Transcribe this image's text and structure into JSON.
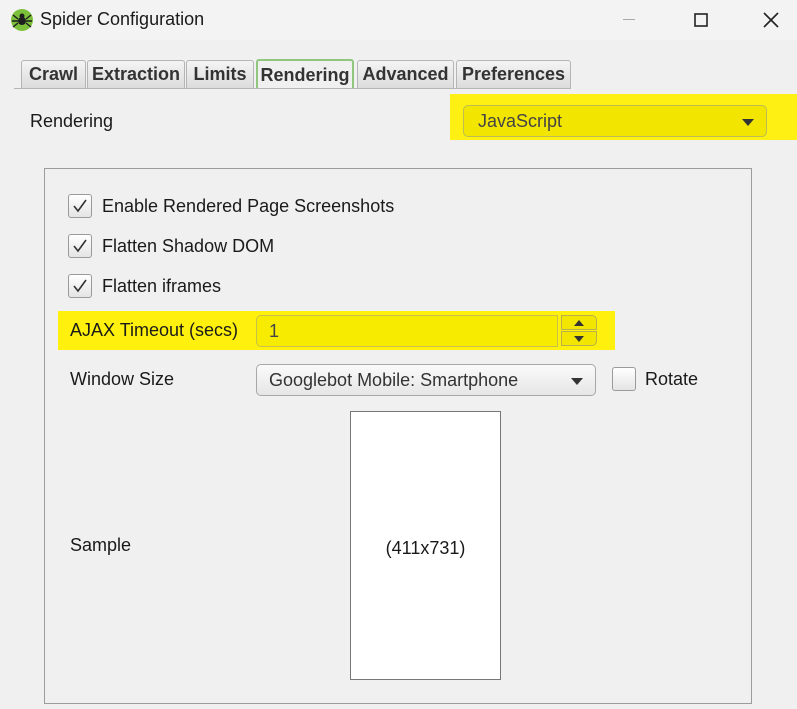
{
  "window": {
    "title": "Spider Configuration",
    "icon": "spider-icon"
  },
  "tabs": [
    {
      "label": "Crawl",
      "active": false
    },
    {
      "label": "Extraction",
      "active": false
    },
    {
      "label": "Limits",
      "active": false
    },
    {
      "label": "Rendering",
      "active": true
    },
    {
      "label": "Advanced",
      "active": false
    },
    {
      "label": "Preferences",
      "active": false
    }
  ],
  "rendering": {
    "label": "Rendering",
    "selected": "JavaScript"
  },
  "options": {
    "screenshots": {
      "label": "Enable Rendered Page Screenshots",
      "checked": true
    },
    "shadow_dom": {
      "label": "Flatten Shadow DOM",
      "checked": true
    },
    "iframes": {
      "label": "Flatten iframes",
      "checked": true
    }
  },
  "ajax": {
    "label": "AJAX Timeout (secs)",
    "value": "1"
  },
  "window_size": {
    "label": "Window Size",
    "selected": "Googlebot Mobile: Smartphone",
    "rotate_label": "Rotate",
    "rotate_checked": false
  },
  "sample": {
    "label": "Sample",
    "dimensions": "(411x731)"
  },
  "colors": {
    "highlight": "#fff000",
    "active_tab_border": "#8fc77f"
  }
}
